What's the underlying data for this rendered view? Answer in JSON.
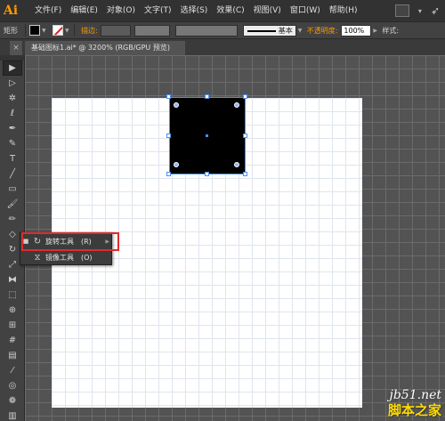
{
  "app": {
    "logo": "Ai"
  },
  "menu": {
    "items": [
      "文件(F)",
      "编辑(E)",
      "对象(O)",
      "文字(T)",
      "选择(S)",
      "效果(C)",
      "视图(V)",
      "窗口(W)",
      "帮助(H)"
    ]
  },
  "control_bar": {
    "object_type": "矩形",
    "stroke_label": "描边:",
    "stroke_profile": "基本",
    "opacity_label": "不透明度:",
    "opacity_value": "100%",
    "style_label": "样式:"
  },
  "document": {
    "tab_title": "基础图标1.ai* @ 3200% (RGB/GPU 预览)",
    "close_glyph": "×"
  },
  "tools": [
    {
      "name": "selection-tool-icon",
      "glyph": "▶",
      "active": true
    },
    {
      "name": "direct-selection-tool-icon",
      "glyph": "▷",
      "active": false
    },
    {
      "name": "magic-wand-tool-icon",
      "glyph": "✲",
      "active": false
    },
    {
      "name": "lasso-tool-icon",
      "glyph": "ℓ",
      "active": false
    },
    {
      "name": "pen-tool-icon",
      "glyph": "✒",
      "active": false
    },
    {
      "name": "curvature-tool-icon",
      "glyph": "✎",
      "active": false
    },
    {
      "name": "type-tool-icon",
      "glyph": "T",
      "active": false
    },
    {
      "name": "line-tool-icon",
      "glyph": "╱",
      "active": false
    },
    {
      "name": "rectangle-tool-icon",
      "glyph": "▭",
      "active": false
    },
    {
      "name": "paintbrush-tool-icon",
      "glyph": "🖌",
      "active": false
    },
    {
      "name": "pencil-tool-icon",
      "glyph": "✏",
      "active": false
    },
    {
      "name": "eraser-tool-icon",
      "glyph": "◇",
      "active": false
    },
    {
      "name": "rotate-tool-icon",
      "glyph": "↻",
      "active": false
    },
    {
      "name": "scale-tool-icon",
      "glyph": "⤢",
      "active": false
    },
    {
      "name": "width-tool-icon",
      "glyph": "⧓",
      "active": false
    },
    {
      "name": "free-transform-tool-icon",
      "glyph": "⬚",
      "active": false
    },
    {
      "name": "shape-builder-tool-icon",
      "glyph": "⊕",
      "active": false
    },
    {
      "name": "perspective-grid-tool-icon",
      "glyph": "⊞",
      "active": false
    },
    {
      "name": "mesh-tool-icon",
      "glyph": "#",
      "active": false
    },
    {
      "name": "gradient-tool-icon",
      "glyph": "▤",
      "active": false
    },
    {
      "name": "eyedropper-tool-icon",
      "glyph": "⁄",
      "active": false
    },
    {
      "name": "blend-tool-icon",
      "glyph": "◎",
      "active": false
    },
    {
      "name": "symbol-sprayer-tool-icon",
      "glyph": "❁",
      "active": false
    },
    {
      "name": "column-graph-tool-icon",
      "glyph": "▥",
      "active": false
    },
    {
      "name": "artboard-tool-icon",
      "glyph": "⌗",
      "active": false
    }
  ],
  "flyout": {
    "items": [
      {
        "bullet": "■",
        "label": "旋转工具",
        "shortcut": "(R)"
      },
      {
        "bullet": "",
        "label": "镜像工具",
        "shortcut": "(O)"
      }
    ]
  },
  "watermark": {
    "line1": "jb51.net",
    "line2": "脚本之家"
  },
  "colors": {
    "accent": "#ff9a00",
    "highlight": "#e12a2a",
    "selection": "#4a8ff0"
  }
}
